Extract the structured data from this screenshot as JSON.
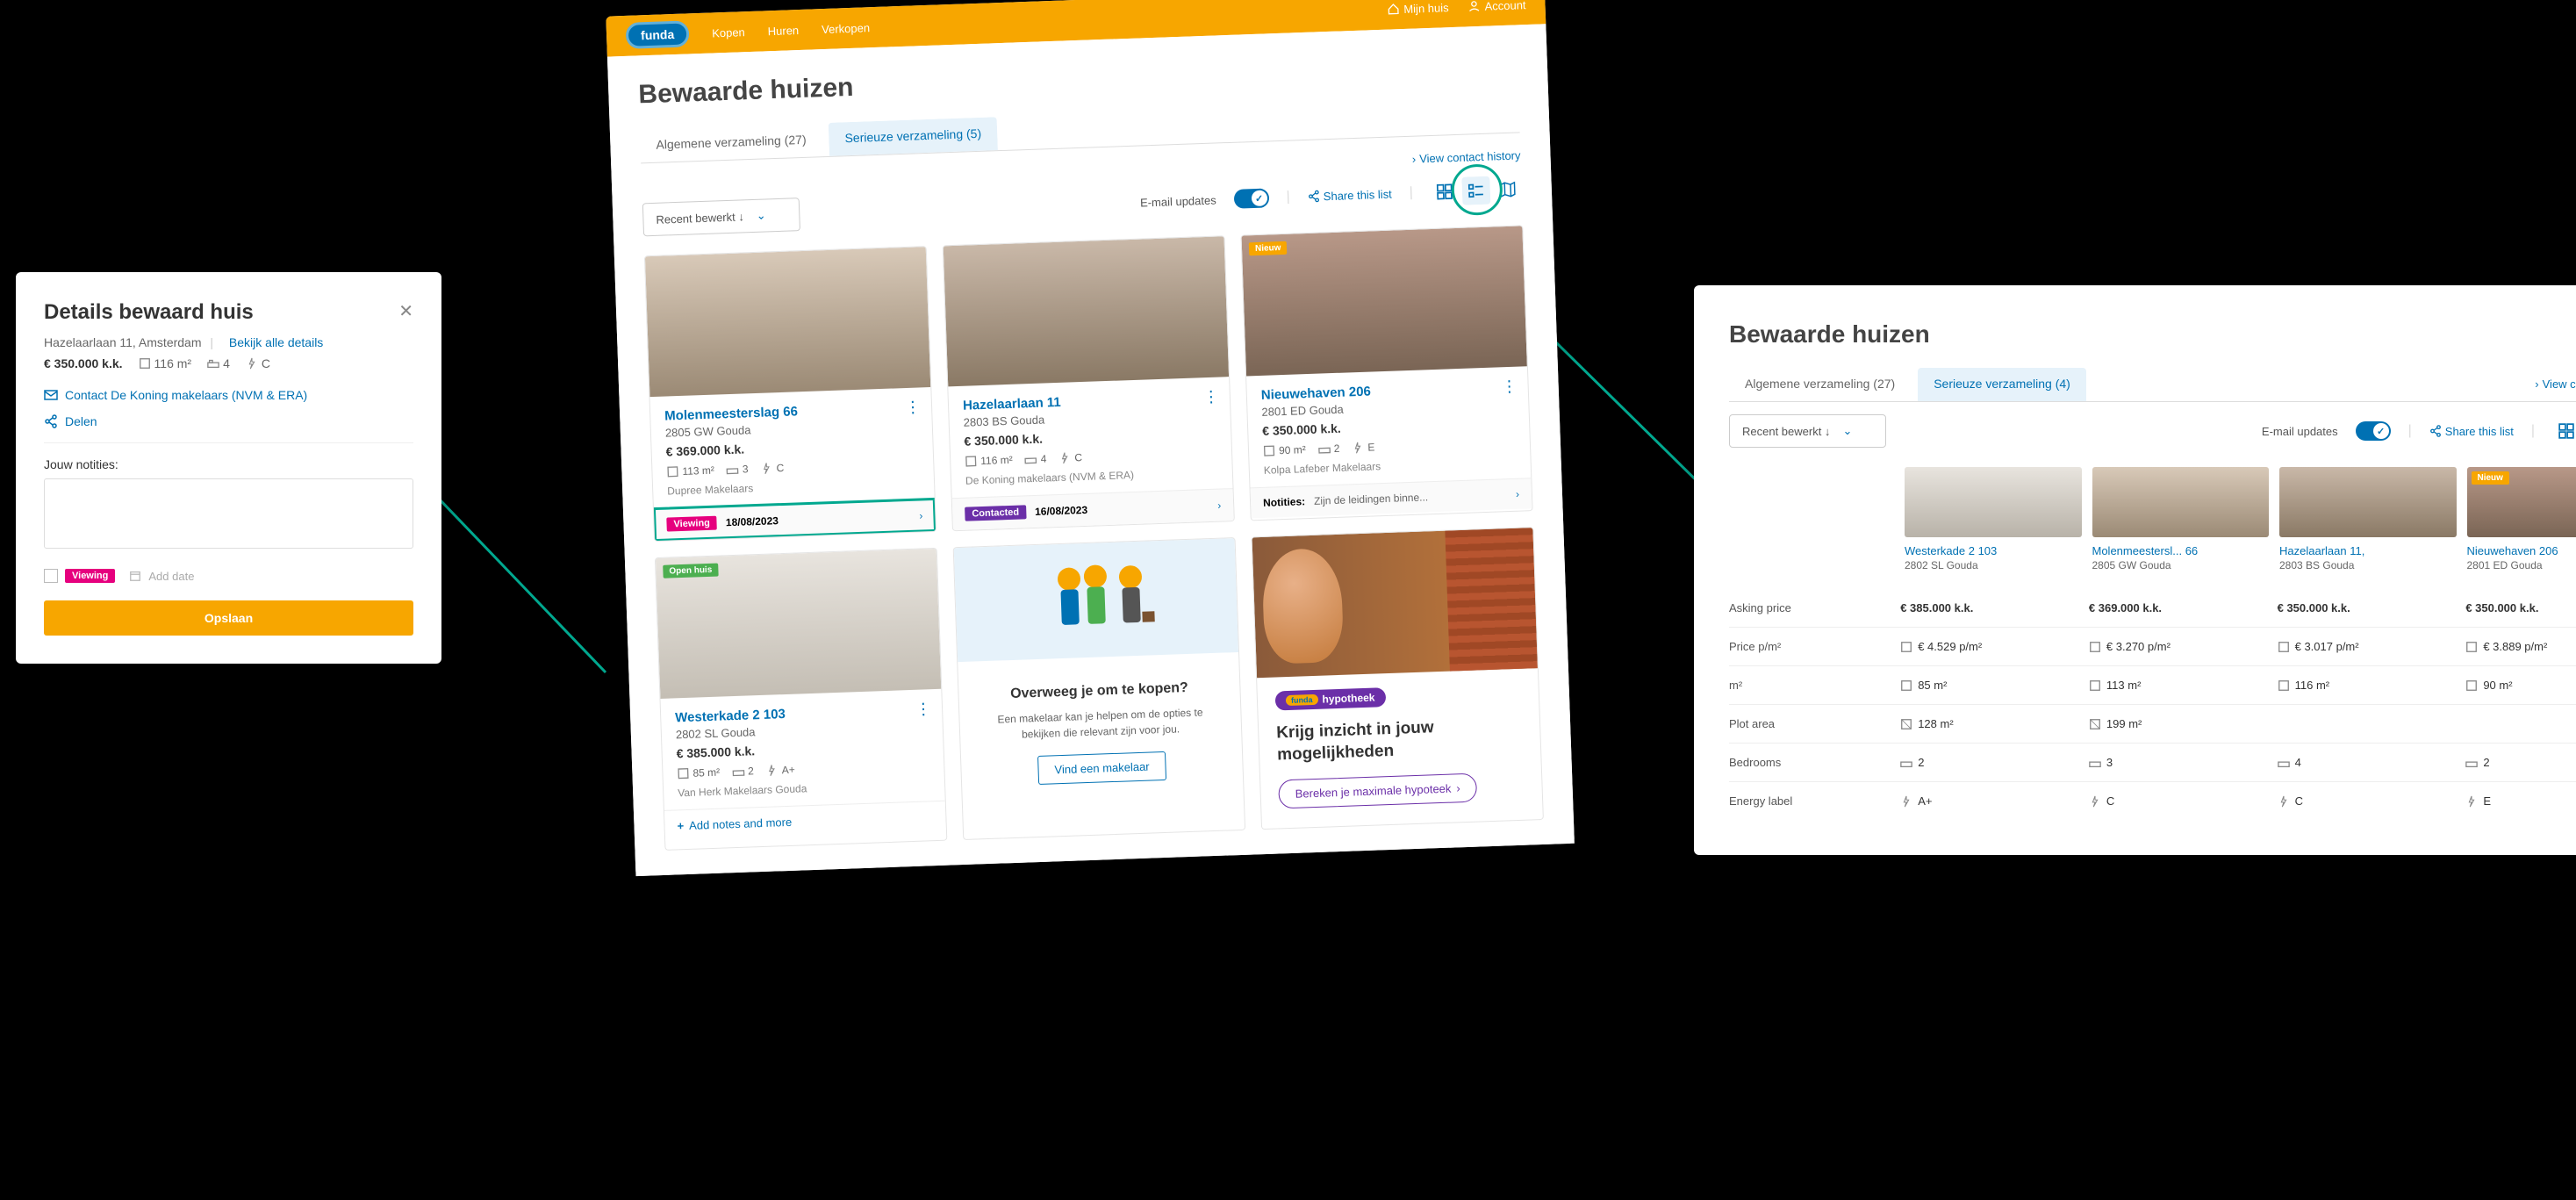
{
  "details": {
    "title": "Details bewaard huis",
    "address": "Hazelaarlaan 11, Amsterdam",
    "view_all": "Bekijk alle details",
    "price": "€ 350.000 k.k.",
    "area": "116 m²",
    "bedrooms": "4",
    "energy": "C",
    "contact": "Contact De Koning makelaars (NVM & ERA)",
    "share": "Delen",
    "notes_label": "Jouw notities:",
    "viewing_tag": "Viewing",
    "add_date": "Add date",
    "save": "Opslaan"
  },
  "main": {
    "logo": "funda",
    "nav": {
      "kopen": "Kopen",
      "huren": "Huren",
      "verkopen": "Verkopen",
      "mijn_huis": "Mijn huis",
      "account": "Account"
    },
    "title": "Bewaarde huizen",
    "tabs": {
      "tab1": "Algemene verzameling (27)",
      "tab2": "Serieuze verzameling (5)"
    },
    "history": "View contact history",
    "sort": "Recent bewerkt ↓",
    "email_updates": "E-mail updates",
    "share_list": "Share this list",
    "cards": [
      {
        "title": "Molenmeesterslag 66",
        "loc": "2805 GW Gouda",
        "price": "€ 369.000 k.k.",
        "area": "113 m²",
        "bed": "3",
        "energy": "C",
        "agent": "Dupree Makelaars",
        "tag": "Viewing",
        "date": "18/08/2023"
      },
      {
        "title": "Hazelaarlaan 11",
        "loc": "2803 BS Gouda",
        "price": "€ 350.000 k.k.",
        "area": "116 m²",
        "bed": "4",
        "energy": "C",
        "agent": "De Koning makelaars (NVM & ERA)",
        "tag": "Contacted",
        "date": "16/08/2023"
      },
      {
        "title": "Nieuwehaven 206",
        "loc": "2801 ED Gouda",
        "price": "€ 350.000 k.k.",
        "area": "90 m²",
        "bed": "2",
        "energy": "E",
        "agent": "Kolpa Lafeber Makelaars",
        "note_prefix": "Notities:",
        "note": "Zijn de leidingen binne...",
        "badge": "Nieuw"
      },
      {
        "title": "Westerkade 2 103",
        "loc": "2802 SL Gouda",
        "price": "€ 385.000 k.k.",
        "area": "85 m²",
        "bed": "2",
        "energy": "A+",
        "agent": "Van Herk Makelaars Gouda",
        "badge": "Open huis",
        "add_link": "Add notes and more"
      }
    ],
    "promo1": {
      "title": "Overweeg je om te kopen?",
      "text": "Een makelaar kan je helpen om de opties te bekijken die relevant zijn voor jou.",
      "btn": "Vind een makelaar"
    },
    "promo2": {
      "badge": "hypotheek",
      "title": "Krijg inzicht in jouw mogelijkheden",
      "btn": "Bereken je maximale hypoteek"
    }
  },
  "compare": {
    "title": "Bewaarde huizen",
    "tabs": {
      "tab1": "Algemene verzameling (27)",
      "tab2": "Serieuze verzameling (4)"
    },
    "history": "View contact history",
    "sort": "Recent bewerkt ↓",
    "email_updates": "E-mail updates",
    "share_list": "Share this list",
    "cols": [
      {
        "name": "Westerkade 2 103",
        "loc": "2802 SL Gouda"
      },
      {
        "name": "Molenmeestersl... 66",
        "loc": "2805 GW Gouda"
      },
      {
        "name": "Hazelaarlaan 11,",
        "loc": "2803 BS Gouda"
      },
      {
        "name": "Nieuwehaven 206",
        "loc": "2801 ED Gouda",
        "badge": "Nieuw"
      }
    ],
    "rows": {
      "asking": {
        "label": "Asking price",
        "v": [
          "€ 385.000 k.k.",
          "€ 369.000 k.k.",
          "€ 350.000 k.k.",
          "€ 350.000 k.k."
        ]
      },
      "ppm": {
        "label": "Price p/m²",
        "v": [
          "€ 4.529 p/m²",
          "€ 3.270 p/m²",
          "€ 3.017 p/m²",
          "€ 3.889 p/m²"
        ]
      },
      "m2": {
        "label": "m²",
        "v": [
          "85 m²",
          "113 m²",
          "116 m²",
          "90 m²"
        ]
      },
      "plot": {
        "label": "Plot area",
        "v": [
          "128 m²",
          "199 m²",
          "",
          ""
        ]
      },
      "bed": {
        "label": "Bedrooms",
        "v": [
          "2",
          "3",
          "4",
          "2"
        ]
      },
      "energy": {
        "label": "Energy label",
        "v": [
          "A+",
          "C",
          "C",
          "E"
        ]
      }
    }
  }
}
